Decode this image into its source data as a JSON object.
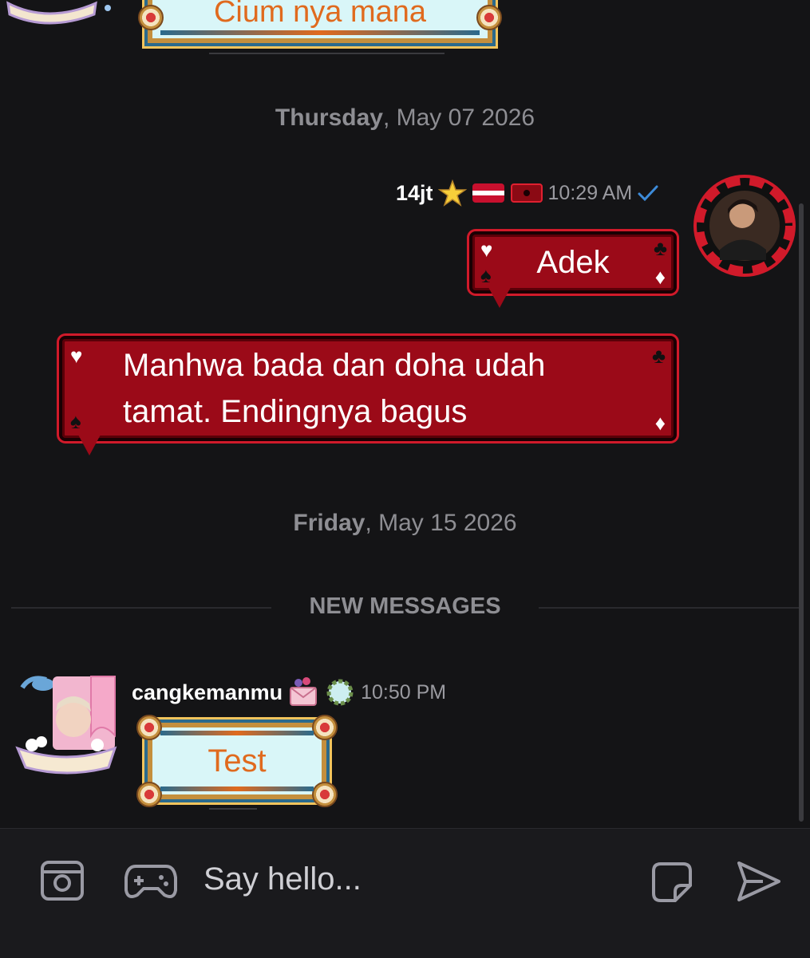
{
  "previous_message": {
    "text": "Cium nya mana"
  },
  "date_separators": [
    {
      "day": "Thursday",
      "rest": ", May 07 2026"
    },
    {
      "day": "Friday",
      "rest": ", May 15 2026"
    }
  ],
  "new_messages_label": "NEW MESSAGES",
  "outgoing": {
    "username": "14jt",
    "time": "10:29 AM",
    "read_icon": "checkmark-icon",
    "messages": [
      "Adek",
      "Manhwa bada dan doha udah tamat. Endingnya bagus"
    ]
  },
  "incoming": {
    "username": "cangkemanmu",
    "time": "10:50 PM",
    "message": "Test"
  },
  "composer": {
    "placeholder": "Say hello...",
    "icons": [
      "camera-icon",
      "gamepad-icon",
      "sticker-icon",
      "send-icon"
    ]
  },
  "colors": {
    "background": "#141416",
    "card_bubble": "#9b0a18",
    "cute_text": "#e06a1e",
    "check": "#3d8bd9"
  }
}
